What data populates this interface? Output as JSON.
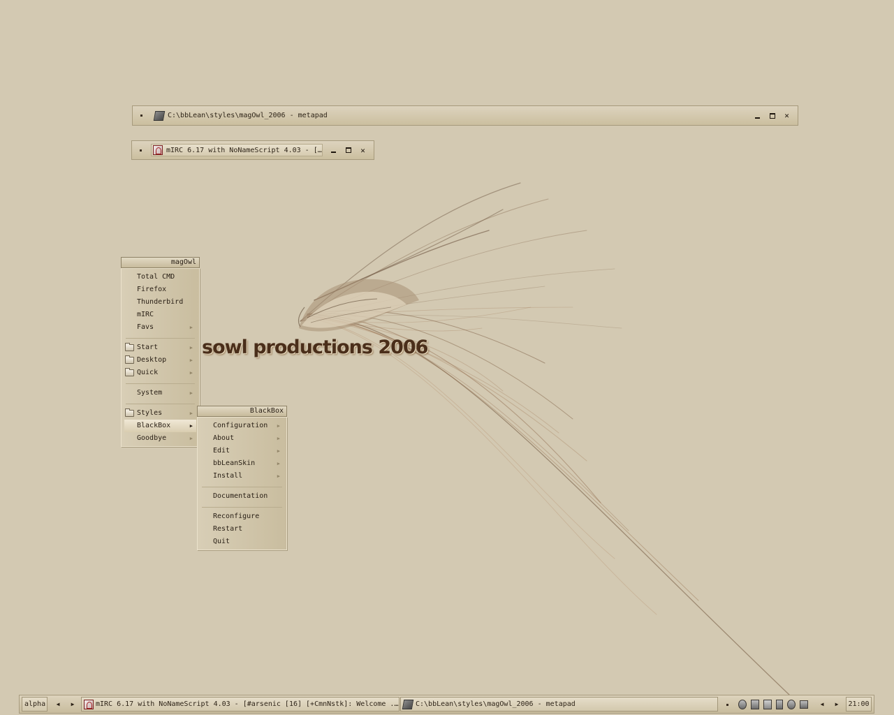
{
  "windows": [
    {
      "title": "C:\\bbLean\\styles\\magOwl_2006 - metapad",
      "icon": "metapad-icon"
    },
    {
      "title": "mIRC 6.17 with NoNameScript 4.03 - [...",
      "icon": "mirc-icon"
    }
  ],
  "wallpaper": {
    "text": "sowl productions 2006"
  },
  "main_menu": {
    "title": "magOwl",
    "items": [
      {
        "label": "Total CMD"
      },
      {
        "label": "Firefox"
      },
      {
        "label": "Thunderbird"
      },
      {
        "label": "mIRC"
      },
      {
        "label": "Favs",
        "submenu": true
      },
      {
        "label": "Start",
        "folder": true,
        "submenu": true
      },
      {
        "label": "Desktop",
        "folder": true,
        "submenu": true
      },
      {
        "label": "Quick",
        "folder": true,
        "submenu": true
      },
      {
        "label": "System",
        "submenu": true
      },
      {
        "label": "Styles",
        "folder": true,
        "submenu": true
      },
      {
        "label": "BlackBox",
        "submenu": true,
        "highlighted": true
      },
      {
        "label": "Goodbye",
        "submenu": true
      }
    ]
  },
  "blackbox_menu": {
    "title": "BlackBox",
    "items": [
      {
        "label": "Configuration",
        "submenu": true
      },
      {
        "label": "About",
        "submenu": true
      },
      {
        "label": "Edit",
        "submenu": true
      },
      {
        "label": "bbLeanSkin",
        "submenu": true
      },
      {
        "label": "Install",
        "submenu": true
      },
      {
        "label": "Documentation"
      },
      {
        "label": "Reconfigure"
      },
      {
        "label": "Restart"
      },
      {
        "label": "Quit"
      }
    ]
  },
  "taskbar": {
    "workspace": "alpha",
    "tasks": [
      {
        "label": "mIRC 6.17 with NoNameScript 4.03 - [#arsenic [16] [+CmnNstk]: Welcome ...",
        "icon": "mirc-icon"
      },
      {
        "label": "C:\\bbLean\\styles\\magOwl_2006 - metapad",
        "icon": "metapad-icon"
      }
    ],
    "clock": "21:00",
    "tray_icons": [
      "volume-icon",
      "network-icon",
      "monitor-icon",
      "speaker-icon",
      "update-icon",
      "printer-icon"
    ]
  },
  "colors": {
    "background": "#d3c9b2",
    "text": "#2e2418",
    "brand": "#4a2e1a"
  }
}
